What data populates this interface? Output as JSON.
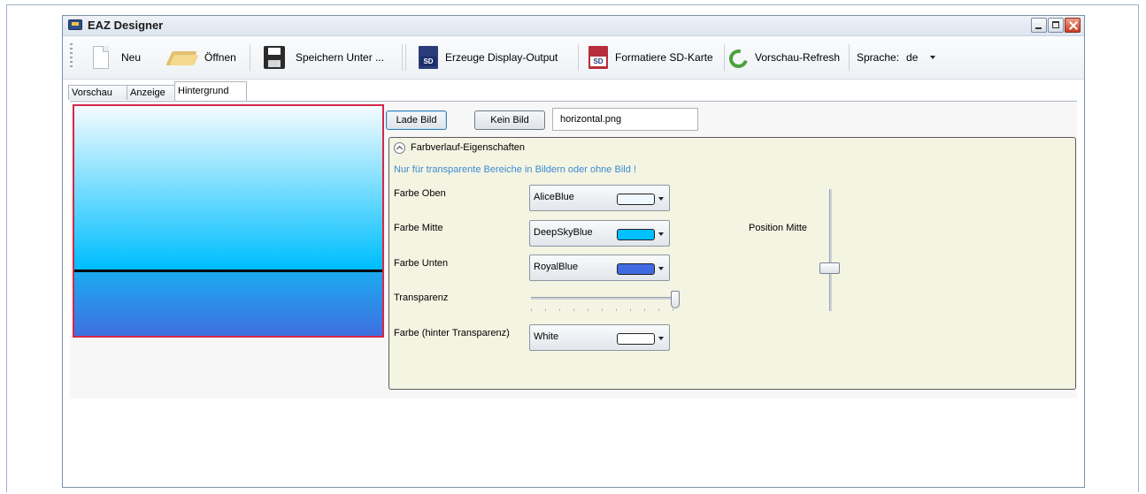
{
  "window": {
    "title": "EAZ Designer"
  },
  "toolbar": {
    "new_label": "Neu",
    "open_label": "Öffnen",
    "save_as_label": "Speichern Unter ...",
    "generate_output_label": "Erzeuge Display-Output",
    "format_sd_label": "Formatiere SD-Karte",
    "refresh_label": "Vorschau-Refresh",
    "language_label": "Sprache:",
    "language_value": "de",
    "sd_icon_text": "SD"
  },
  "tabs": [
    {
      "label": "Vorschau"
    },
    {
      "label": "Anzeige"
    },
    {
      "label": "Hintergrund",
      "active": true
    }
  ],
  "background": {
    "load_image_label": "Lade Bild",
    "no_image_label": "Kein Bild",
    "image_filename": "horizontal.png",
    "gradient_header": "Farbverlauf-Eigenschaften",
    "note": "Nur für transparente Bereiche in Bildern oder ohne Bild !",
    "color_top_label": "Farbe Oben",
    "color_top_value": "AliceBlue",
    "color_top_hex": "#F0F8FF",
    "color_mid_label": "Farbe Mitte",
    "color_mid_value": "DeepSkyBlue",
    "color_mid_hex": "#00BFFF",
    "color_bottom_label": "Farbe Unten",
    "color_bottom_value": "RoyalBlue",
    "color_bottom_hex": "#4169E1",
    "transparency_label": "Transparenz",
    "transparency_value": 1.0,
    "behind_color_label": "Farbe (hinter Transparenz)",
    "behind_color_value": "White",
    "behind_color_hex": "#FFFFFF",
    "position_mid_label": "Position Mitte",
    "position_mid_value": 0.33
  }
}
